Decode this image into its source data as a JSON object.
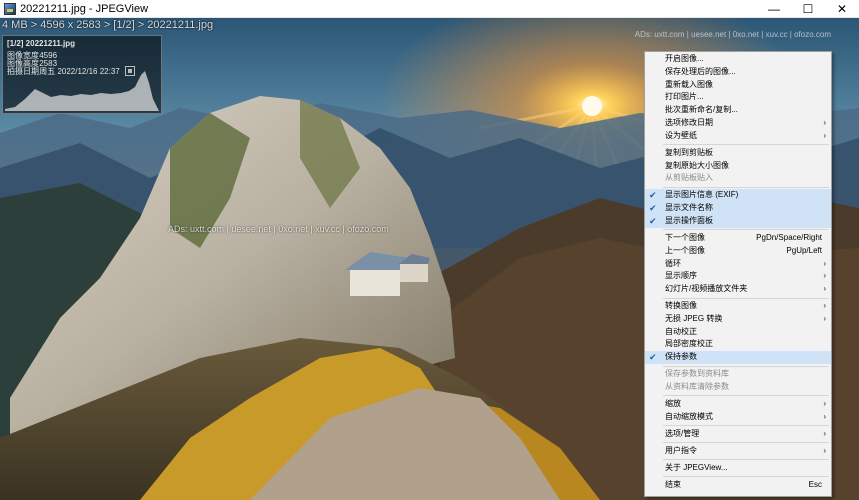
{
  "window": {
    "title": "20221211.jpg - JPEGView",
    "controls": {
      "minimize": "—",
      "maximize": "☐",
      "close": "✕"
    }
  },
  "overlay": {
    "path_label": "4 MB > 4596 x 2583 > [1/2] > 20221211.jpg",
    "ads_top": "ADs:  uxtt.com | uesee.net | 0xo.net | xuv.cc | ofozo.com",
    "ads_mid": "ADs:  uxtt.com | uesee.net | 0xo.net | xuv.cc | ofozo.com"
  },
  "info_panel": {
    "title": "[1/2]  20221211.jpg",
    "rows": [
      {
        "key": "图像宽度",
        "value": "4596"
      },
      {
        "key": "图像高度",
        "value": "2583"
      },
      {
        "key": "拍摄日期",
        "value": "周五 2022/12/16 22:37"
      }
    ]
  },
  "menu": {
    "items": [
      {
        "type": "item",
        "label": "开启图像..."
      },
      {
        "type": "item",
        "label": "保存处理后的图像..."
      },
      {
        "type": "item",
        "label": "重新载入图像"
      },
      {
        "type": "item",
        "label": "打印图片..."
      },
      {
        "type": "item",
        "label": "批次重新命名/复制..."
      },
      {
        "type": "item",
        "label": "选项修改日期",
        "submenu": true
      },
      {
        "type": "item",
        "label": "设为壁纸",
        "submenu": true
      },
      {
        "type": "separator"
      },
      {
        "type": "item",
        "label": "复制到剪贴板"
      },
      {
        "type": "item",
        "label": "复制原始大小图像"
      },
      {
        "type": "item",
        "label": "从剪贴板贴入",
        "disabled": true
      },
      {
        "type": "separator"
      },
      {
        "type": "item",
        "label": "显示图片信息 (EXIF)",
        "checked": true
      },
      {
        "type": "item",
        "label": "显示文件名称",
        "checked": true
      },
      {
        "type": "item",
        "label": "显示操作面板",
        "checked": true
      },
      {
        "type": "separator"
      },
      {
        "type": "item",
        "label": "下一个图像",
        "accel": "PgDn/Space/Right"
      },
      {
        "type": "item",
        "label": "上一个图像",
        "accel": "PgUp/Left"
      },
      {
        "type": "item",
        "label": "循环",
        "submenu": true
      },
      {
        "type": "item",
        "label": "显示顺序",
        "submenu": true
      },
      {
        "type": "item",
        "label": "幻灯片/视频播放文件夹",
        "submenu": true
      },
      {
        "type": "separator"
      },
      {
        "type": "item",
        "label": "转换图像",
        "submenu": true
      },
      {
        "type": "item",
        "label": "无损 JPEG 转换",
        "submenu": true
      },
      {
        "type": "item",
        "label": "自动校正"
      },
      {
        "type": "item",
        "label": "局部密度校正"
      },
      {
        "type": "item",
        "label": "保持参数",
        "checked": true
      },
      {
        "type": "separator"
      },
      {
        "type": "item",
        "label": "保存参数到资料库",
        "disabled": true
      },
      {
        "type": "item",
        "label": "从资料库清除参数",
        "disabled": true
      },
      {
        "type": "separator"
      },
      {
        "type": "item",
        "label": "缩放",
        "submenu": true
      },
      {
        "type": "item",
        "label": "自动缩放模式",
        "submenu": true
      },
      {
        "type": "separator"
      },
      {
        "type": "item",
        "label": "选项/管理",
        "submenu": true
      },
      {
        "type": "separator"
      },
      {
        "type": "item",
        "label": "用户指令",
        "submenu": true
      },
      {
        "type": "separator"
      },
      {
        "type": "item",
        "label": "关于 JPEGView..."
      },
      {
        "type": "separator"
      },
      {
        "type": "item",
        "label": "结束",
        "accel": "Esc"
      }
    ]
  }
}
